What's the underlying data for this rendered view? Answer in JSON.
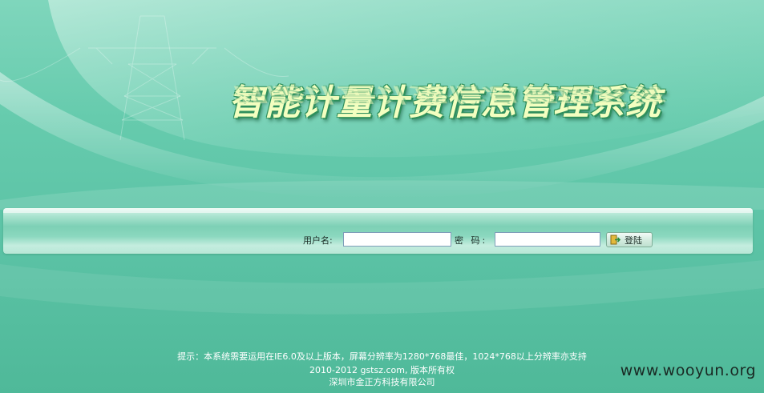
{
  "header": {
    "title": "智能计量计费信息管理系统"
  },
  "login": {
    "username_label": "用户名:",
    "username_value": "",
    "password_label": "密 码:",
    "password_value": "",
    "submit_label": "登陆"
  },
  "footer": {
    "hint": "提示：本系统需要运用在IE6.0及以上版本，屏幕分辨率为1280*768最佳，1024*768以上分辨率亦支持",
    "copyright": "2010-2012 gstsz.com, 版本所有权",
    "company": "深圳市金正方科技有限公司"
  },
  "watermark": "www.wooyun.org",
  "colors": {
    "background": "#66cbad",
    "title_fill": "#f3ffc0",
    "title_outline": "#2f8f5c",
    "login_bar": "#8bd8bf"
  }
}
